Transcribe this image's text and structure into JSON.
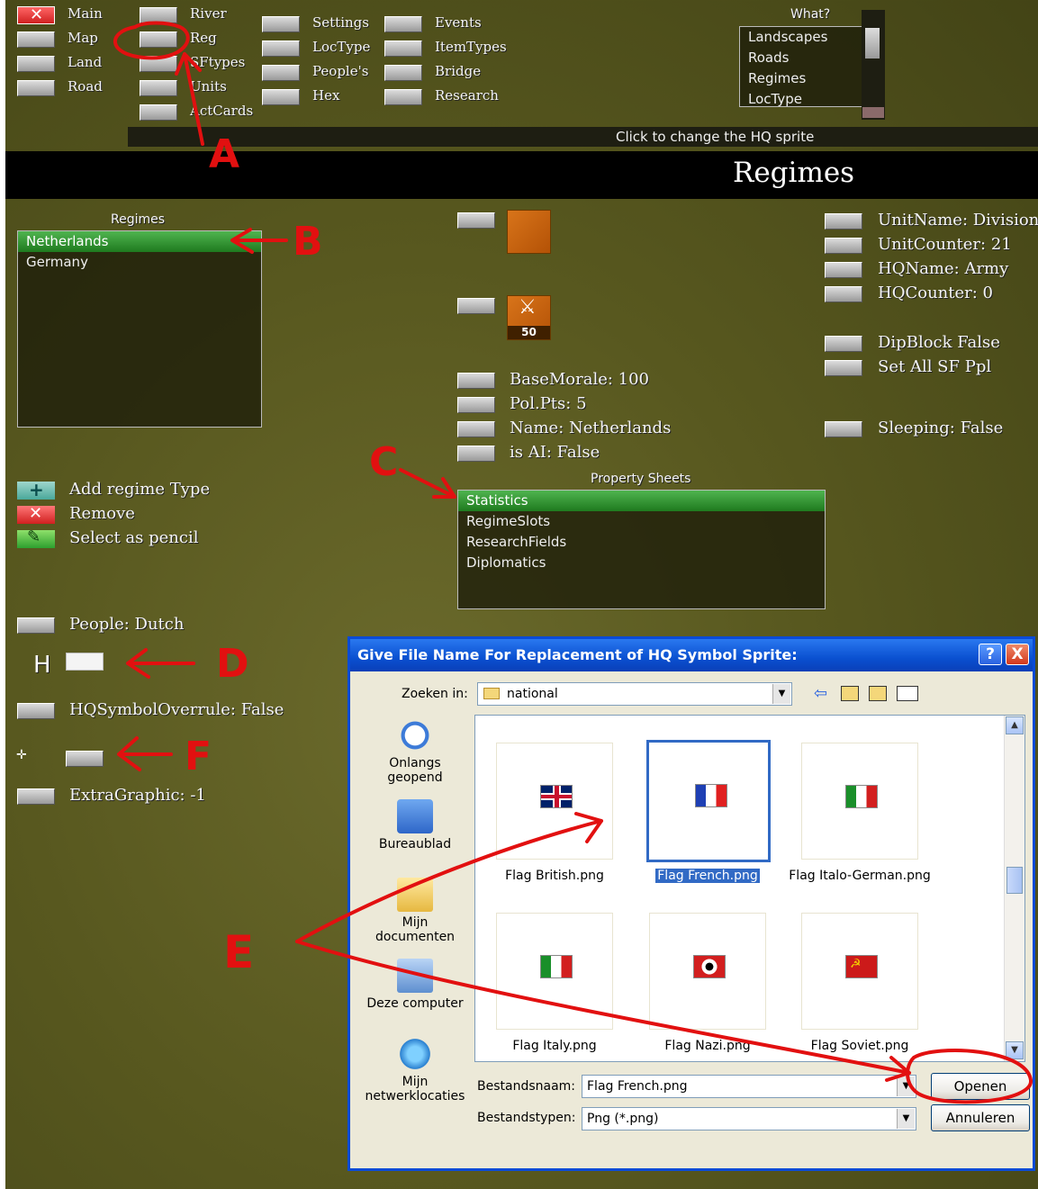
{
  "colors": {
    "accent_green": "#2e8b2e",
    "dialog_blue": "#0a50d0",
    "annotation_red": "#e21010"
  },
  "toolbar": {
    "col1": [
      "Main",
      "Map",
      "Land",
      "Road"
    ],
    "col2": [
      "River",
      "Reg",
      "SFtypes",
      "Units",
      "ActCards"
    ],
    "col3": [
      "Settings",
      "LocType",
      "People's",
      "Hex"
    ],
    "col4": [
      "Events",
      "ItemTypes",
      "Bridge",
      "Research"
    ],
    "what_label": "What?",
    "what_list": [
      "Landscapes",
      "Roads",
      "Regimes",
      "LocType"
    ],
    "status": "Click to change the HQ sprite"
  },
  "header": {
    "title": "Regimes"
  },
  "regimes": {
    "label": "Regimes",
    "items": [
      "Netherlands",
      "Germany"
    ],
    "actions": [
      "Add regime Type",
      "Remove",
      "Select as pencil"
    ],
    "people": "People: Dutch",
    "hq_label": "H",
    "hq_override": "HQSymbolOverrule: False",
    "extra_graphic": "ExtraGraphic: -1"
  },
  "center": {
    "unit_counter": "50",
    "props": [
      "BaseMorale:  100",
      "Pol.Pts:  5",
      "Name: Netherlands",
      "is AI: False"
    ],
    "sheets_label": "Property Sheets",
    "sheets": [
      "Statistics",
      "RegimeSlots",
      "ResearchFields",
      "Diplomatics"
    ]
  },
  "right": {
    "props1": [
      "UnitName: Division",
      "UnitCounter:  21",
      "HQName: Army",
      "HQCounter:  0"
    ],
    "props2": [
      "DipBlock False",
      "Set All SF Ppl"
    ],
    "props3": [
      "Sleeping: False"
    ]
  },
  "dialog": {
    "title": "Give File Name For Replacement of HQ Symbol Sprite:",
    "look_in_label": "Zoeken in:",
    "look_in_value": "national",
    "places": [
      "Onlangs geopend",
      "Bureaublad",
      "Mijn documenten",
      "Deze computer",
      "Mijn netwerklocaties"
    ],
    "files": [
      {
        "name": "Flag British.png",
        "icon": "flag-british-icon"
      },
      {
        "name": "Flag French.png",
        "icon": "flag-french-icon"
      },
      {
        "name": "Flag Italo-German.png",
        "icon": "flag-italo-german-icon"
      },
      {
        "name": "Flag Italy.png",
        "icon": "flag-italy-icon"
      },
      {
        "name": "Flag Nazi.png",
        "icon": "flag-nazi-icon"
      },
      {
        "name": "Flag Soviet.png",
        "icon": "flag-soviet-icon"
      }
    ],
    "filename_label": "Bestandsnaam:",
    "filename_value": "Flag French.png",
    "filetype_label": "Bestandstypen:",
    "filetype_value": "Png (*.png)",
    "open_button": "Openen",
    "cancel_button": "Annuleren",
    "help_button": "?",
    "close_button": "X"
  },
  "annotations": [
    "A",
    "B",
    "C",
    "D",
    "E",
    "F"
  ]
}
